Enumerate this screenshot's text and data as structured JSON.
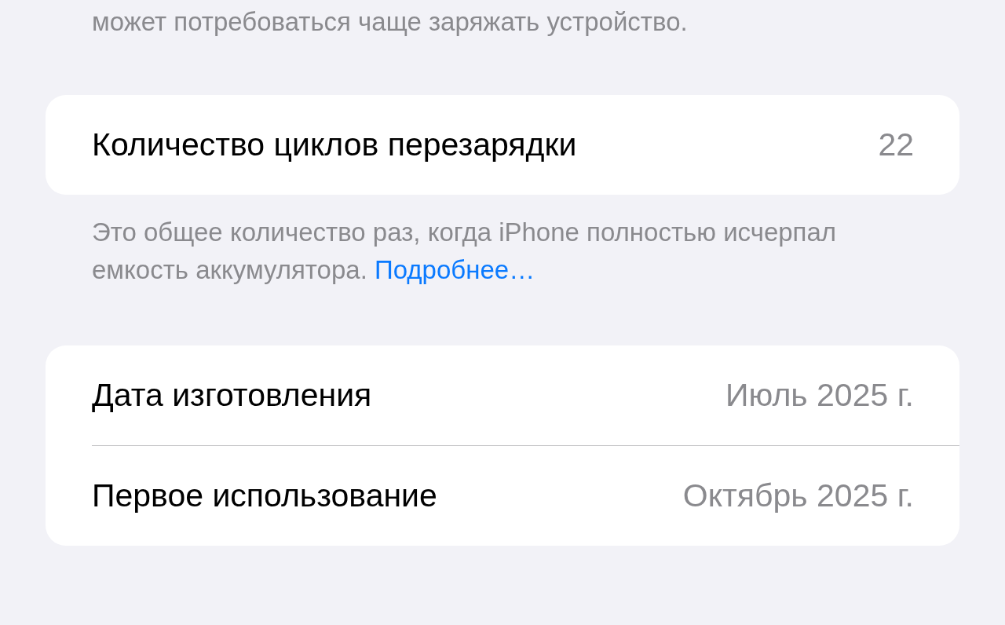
{
  "intro_text": "может потребоваться чаще заряжать устройство.",
  "cycle_card": {
    "rows": [
      {
        "label": "Количество циклов перезарядки",
        "value": "22"
      }
    ]
  },
  "cycle_footer": {
    "text": "Это общее количество раз, когда iPhone полностью исчерпал емкость аккумулятора.",
    "link": "Подробнее…"
  },
  "dates_card": {
    "rows": [
      {
        "label": "Дата изготовления",
        "value": "Июль 2025 г."
      },
      {
        "label": "Первое использование",
        "value": "Октябрь 2025 г."
      }
    ]
  }
}
